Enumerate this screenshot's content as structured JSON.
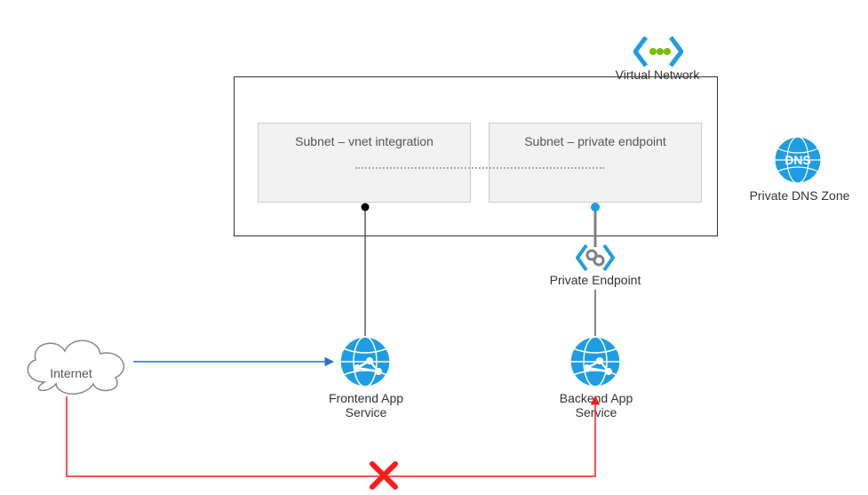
{
  "vnet": {
    "label": "Virtual Network"
  },
  "subnet1": {
    "label": "Subnet – vnet integration"
  },
  "subnet2": {
    "label": "Subnet – private endpoint"
  },
  "dns": {
    "label": "Private DNS Zone"
  },
  "privateEndpoint": {
    "label": "Private Endpoint"
  },
  "frontend": {
    "label": "Frontend App Service"
  },
  "backend": {
    "label": "Backend App Service"
  },
  "internet": {
    "label": "Internet"
  },
  "colors": {
    "azureBlue": "#1e9de3",
    "azureDark": "#2f5f8f",
    "green": "#7abd00",
    "red": "#ff1a1a",
    "gray": "#808080"
  },
  "chart_data": {
    "type": "diagram",
    "title": "Azure App Service Private Endpoint network topology",
    "nodes": [
      {
        "id": "internet",
        "label": "Internet"
      },
      {
        "id": "frontend",
        "label": "Frontend App Service"
      },
      {
        "id": "backend",
        "label": "Backend App Service"
      },
      {
        "id": "vnet",
        "label": "Virtual Network"
      },
      {
        "id": "subnet-integration",
        "label": "Subnet – vnet integration",
        "parent": "vnet"
      },
      {
        "id": "subnet-pe",
        "label": "Subnet – private endpoint",
        "parent": "vnet"
      },
      {
        "id": "private-endpoint",
        "label": "Private Endpoint"
      },
      {
        "id": "dns",
        "label": "Private DNS Zone"
      }
    ],
    "edges": [
      {
        "from": "internet",
        "to": "frontend",
        "allowed": true
      },
      {
        "from": "internet",
        "to": "backend",
        "allowed": false
      },
      {
        "from": "frontend",
        "to": "subnet-integration",
        "allowed": true
      },
      {
        "from": "subnet-integration",
        "to": "subnet-pe",
        "allowed": true
      },
      {
        "from": "subnet-pe",
        "to": "private-endpoint",
        "allowed": true
      },
      {
        "from": "private-endpoint",
        "to": "backend",
        "allowed": true
      }
    ]
  }
}
